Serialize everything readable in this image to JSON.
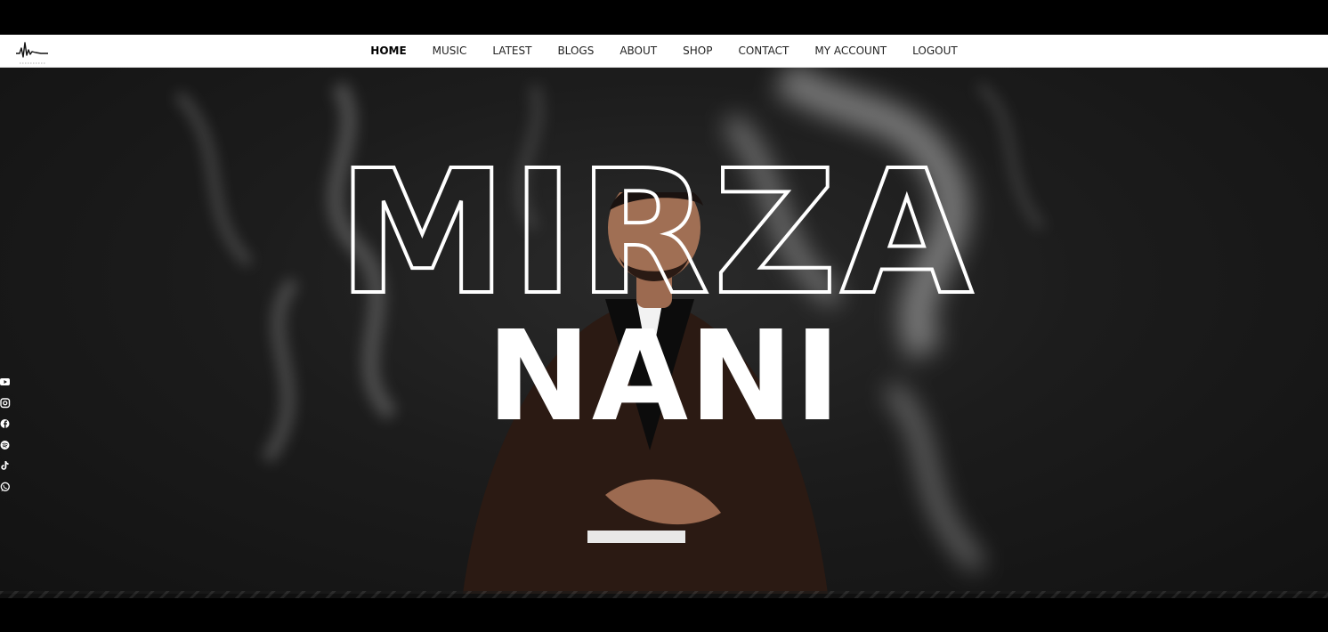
{
  "nav": {
    "items": [
      {
        "label": "HOME",
        "active": true
      },
      {
        "label": "MUSIC",
        "active": false
      },
      {
        "label": "LATEST",
        "active": false
      },
      {
        "label": "BLOGS",
        "active": false
      },
      {
        "label": "ABOUT",
        "active": false
      },
      {
        "label": "SHOP",
        "active": false
      },
      {
        "label": "CONTACT",
        "active": false
      },
      {
        "label": "MY ACCOUNT",
        "active": false
      },
      {
        "label": "LOGOUT",
        "active": false
      }
    ]
  },
  "logo": {
    "icon": "soundwave-logo-icon"
  },
  "hero": {
    "title_outline": "MIRZA",
    "title_solid": "NANI"
  },
  "social": {
    "icons": [
      "youtube-icon",
      "instagram-icon",
      "facebook-icon",
      "spotify-icon",
      "tiktok-icon",
      "whatsapp-icon"
    ]
  },
  "colors": {
    "nav_bg": "#ffffff",
    "hero_bg": "#1c1c1c",
    "text_light": "#ffffff",
    "text_dark": "#222222"
  }
}
